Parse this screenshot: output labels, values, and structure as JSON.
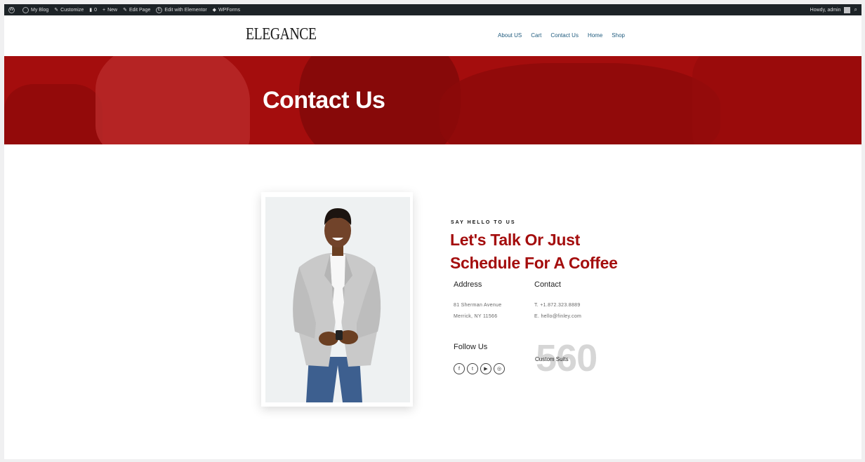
{
  "admin_bar": {
    "items": [
      "My Blog",
      "Customize",
      "0",
      "New",
      "Edit Page",
      "Edit with Elementor",
      "WPForms"
    ],
    "howdy": "Howdy, admin"
  },
  "header": {
    "logo": "ELEGANCE",
    "nav": [
      "About US",
      "Cart",
      "Contact Us",
      "Home",
      "Shop"
    ]
  },
  "hero": {
    "title": "Contact Us"
  },
  "contact": {
    "eyebrow": "SAY HELLO TO US",
    "headline": "Let's Talk Or Just Schedule For A Coffee",
    "address_title": "Address",
    "address_line1": "81 Sherman Avenue",
    "address_line2": "Merrick, NY 11566",
    "contact_title": "Contact",
    "phone": "T. +1.872.323.8889",
    "email": "E. hello@finley.com",
    "follow_title": "Follow Us",
    "counter_value": "560",
    "counter_label": "Custom Suits"
  },
  "social_icons": [
    "facebook-icon",
    "twitter-icon",
    "youtube-icon",
    "instagram-icon"
  ]
}
